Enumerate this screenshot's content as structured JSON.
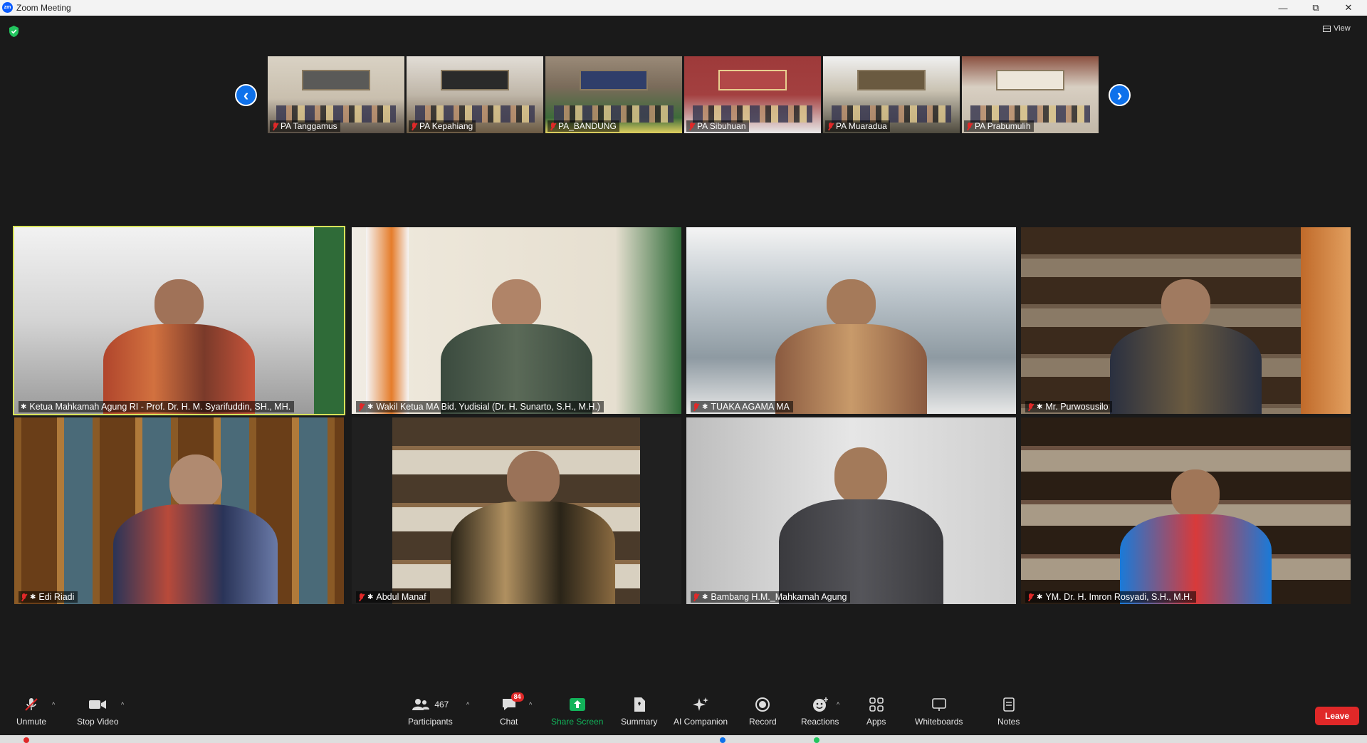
{
  "window": {
    "title": "Zoom Meeting",
    "app_icon_text": "zm"
  },
  "view_button": {
    "label": "View"
  },
  "strip": {
    "thumbnails": [
      {
        "name": "PA Tanggamus"
      },
      {
        "name": "PA Kepahiang"
      },
      {
        "name": "PA_BANDUNG"
      },
      {
        "name": "PA Sibuhuan"
      },
      {
        "name": "PA Muaradua"
      },
      {
        "name": "PA Prabumulih"
      }
    ]
  },
  "grid": {
    "participants": [
      {
        "name": "Ketua Mahkamah Agung RI - Prof. Dr. H. M. Syarifuddin, SH., MH."
      },
      {
        "name": "Wakil Ketua MA Bid. Yudisial (Dr. H. Sunarto, S.H., M.H.)"
      },
      {
        "name": "TUAKA AGAMA MA"
      },
      {
        "name": "Mr. Purwosusilo"
      },
      {
        "name": "Edi Riadi"
      },
      {
        "name": "Abdul Manaf"
      },
      {
        "name": "Bambang H.M._Mahkamah Agung"
      },
      {
        "name": "YM. Dr. H. Imron Rosyadi, S.H., M.H."
      }
    ]
  },
  "toolbar": {
    "unmute": "Unmute",
    "stop_video": "Stop Video",
    "participants": "Participants",
    "participants_count": "467",
    "chat": "Chat",
    "chat_badge": "84",
    "share_screen": "Share Screen",
    "summary": "Summary",
    "ai_companion": "AI Companion",
    "record": "Record",
    "reactions": "Reactions",
    "apps": "Apps",
    "whiteboards": "Whiteboards",
    "notes": "Notes",
    "leave": "Leave"
  },
  "colors": {
    "accent_blue": "#0e71eb",
    "share_green": "#12b35a",
    "leave_red": "#e02828",
    "active_speaker_border": "#d8e35a"
  }
}
